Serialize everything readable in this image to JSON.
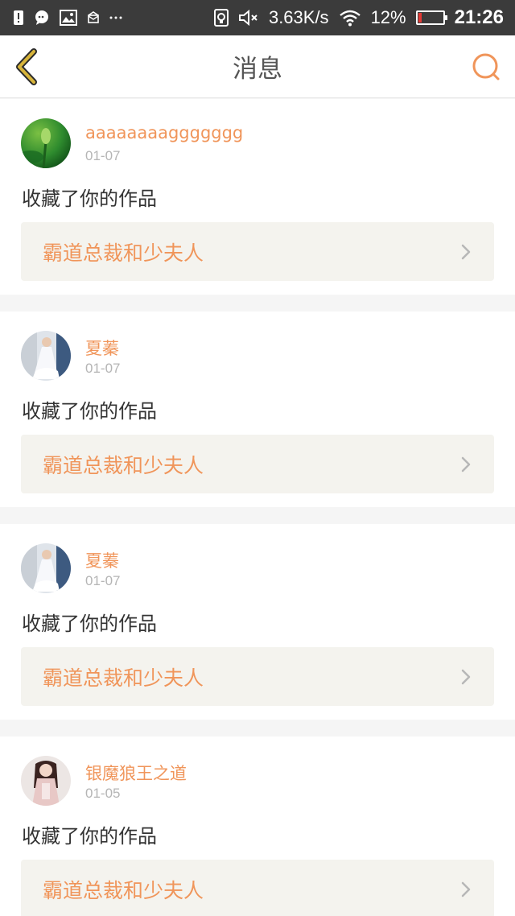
{
  "status_bar": {
    "network_speed": "3.63K/s",
    "battery_percent": "12%",
    "battery_level": 0.12,
    "time": "21:26",
    "icons": [
      "alert-icon",
      "chat-icon",
      "image-icon",
      "mail-icon",
      "more-icon",
      "sim-icon",
      "mute-icon",
      "wifi-icon",
      "battery-icon"
    ]
  },
  "header": {
    "title": "消息",
    "back_icon": "chevron-left-icon",
    "search_icon": "search-icon"
  },
  "colors": {
    "accent": "#f0955a",
    "back_icon": "#d7b43a",
    "status_bar_bg": "#3b3b3b",
    "work_bg": "#f4f3ee"
  },
  "messages": [
    {
      "username": "aaaaaaaaggggggg",
      "date": "01-07",
      "action": "收藏了你的作品",
      "work_title": "霸道总裁和少夫人",
      "avatar": "lotus-avatar"
    },
    {
      "username": "夏蓁",
      "date": "01-07",
      "action": "收藏了你的作品",
      "work_title": "霸道总裁和少夫人",
      "avatar": "girl-white-dress-avatar"
    },
    {
      "username": "夏蓁",
      "date": "01-07",
      "action": "收藏了你的作品",
      "work_title": "霸道总裁和少夫人",
      "avatar": "girl-white-dress-avatar"
    },
    {
      "username": "银魔狼王之道",
      "date": "01-05",
      "action": "收藏了你的作品",
      "work_title": "霸道总裁和少夫人",
      "avatar": "girl-portrait-avatar"
    }
  ]
}
